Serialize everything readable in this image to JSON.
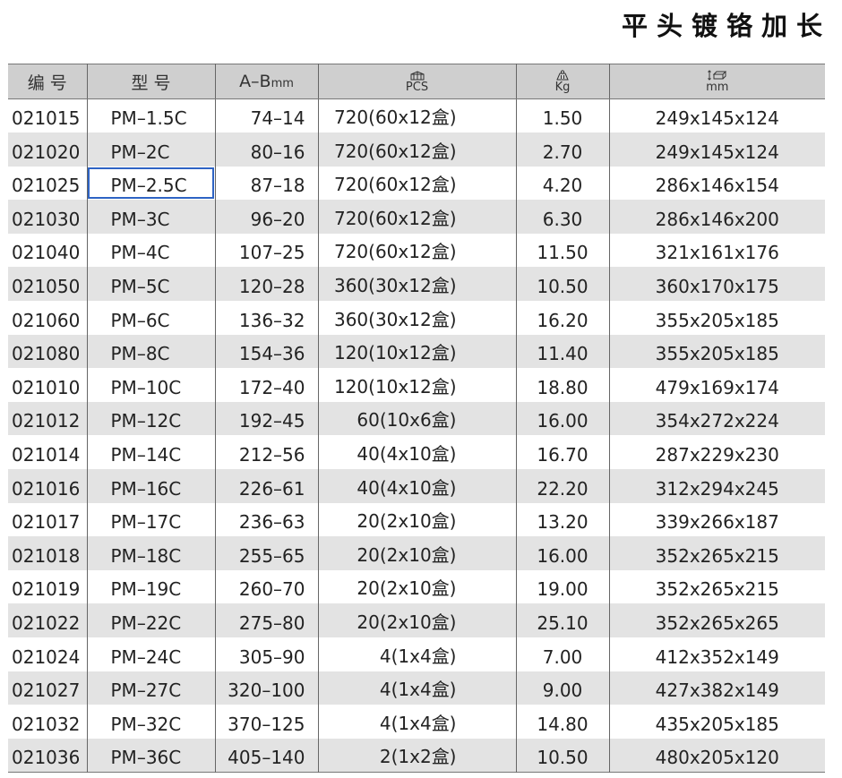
{
  "title": "平头镀铬加长",
  "header": {
    "code": "编  号",
    "model": "型  号",
    "ab": "A–B",
    "ab_unit": "mm",
    "pcs": "PCS",
    "kg": "Kg",
    "mm": "mm",
    "pcs_icon": "box-icon",
    "kg_icon": "weight-icon",
    "mm_icon": "carton-dimension-icon"
  },
  "selected_row": 2,
  "selected_col": "model",
  "rows": [
    {
      "code": "021015",
      "model": "PM–1.5C",
      "ab": "74–14",
      "pcs": "720(60x12盒)",
      "kg": "1.50",
      "mm": "249x145x124"
    },
    {
      "code": "021020",
      "model": "PM–2C",
      "ab": "80–16",
      "pcs": "720(60x12盒)",
      "kg": "2.70",
      "mm": "249x145x124"
    },
    {
      "code": "021025",
      "model": "PM–2.5C",
      "ab": "87–18",
      "pcs": "720(60x12盒)",
      "kg": "4.20",
      "mm": "286x146x154"
    },
    {
      "code": "021030",
      "model": "PM–3C",
      "ab": "96–20",
      "pcs": "720(60x12盒)",
      "kg": "6.30",
      "mm": "286x146x200"
    },
    {
      "code": "021040",
      "model": "PM–4C",
      "ab": "107–25",
      "pcs": "720(60x12盒)",
      "kg": "11.50",
      "mm": "321x161x176"
    },
    {
      "code": "021050",
      "model": "PM–5C",
      "ab": "120–28",
      "pcs": "360(30x12盒)",
      "kg": "10.50",
      "mm": "360x170x175"
    },
    {
      "code": "021060",
      "model": "PM–6C",
      "ab": "136–32",
      "pcs": "360(30x12盒)",
      "kg": "16.20",
      "mm": "355x205x185"
    },
    {
      "code": "021080",
      "model": "PM–8C",
      "ab": "154–36",
      "pcs": "120(10x12盒)",
      "kg": "11.40",
      "mm": "355x205x185"
    },
    {
      "code": "021010",
      "model": "PM–10C",
      "ab": "172–40",
      "pcs": "120(10x12盒)",
      "kg": "18.80",
      "mm": "479x169x174"
    },
    {
      "code": "021012",
      "model": "PM–12C",
      "ab": "192–45",
      "pcs": "60(10x6盒)",
      "kg": "16.00",
      "mm": "354x272x224"
    },
    {
      "code": "021014",
      "model": "PM–14C",
      "ab": "212–56",
      "pcs": "40(4x10盒)",
      "kg": "16.70",
      "mm": "287x229x230"
    },
    {
      "code": "021016",
      "model": "PM–16C",
      "ab": "226–61",
      "pcs": "40(4x10盒)",
      "kg": "22.20",
      "mm": "312x294x245"
    },
    {
      "code": "021017",
      "model": "PM–17C",
      "ab": "236–63",
      "pcs": "20(2x10盒)",
      "kg": "13.20",
      "mm": "339x266x187"
    },
    {
      "code": "021018",
      "model": "PM–18C",
      "ab": "255–65",
      "pcs": "20(2x10盒)",
      "kg": "16.00",
      "mm": "352x265x215"
    },
    {
      "code": "021019",
      "model": "PM–19C",
      "ab": "260–70",
      "pcs": "20(2x10盒)",
      "kg": "19.00",
      "mm": "352x265x215"
    },
    {
      "code": "021022",
      "model": "PM–22C",
      "ab": "275–80",
      "pcs": "20(2x10盒)",
      "kg": "25.10",
      "mm": "352x265x265"
    },
    {
      "code": "021024",
      "model": "PM–24C",
      "ab": "305–90",
      "pcs": "4(1x4盒)",
      "kg": "7.00",
      "mm": "412x352x149"
    },
    {
      "code": "021027",
      "model": "PM–27C",
      "ab": "320–100",
      "pcs": "4(1x4盒)",
      "kg": "9.00",
      "mm": "427x382x149"
    },
    {
      "code": "021032",
      "model": "PM–32C",
      "ab": "370–125",
      "pcs": "4(1x4盒)",
      "kg": "14.80",
      "mm": "435x205x185"
    },
    {
      "code": "021036",
      "model": "PM–36C",
      "ab": "405–140",
      "pcs": "2(1x2盒)",
      "kg": "10.50",
      "mm": "480x205x120"
    }
  ]
}
